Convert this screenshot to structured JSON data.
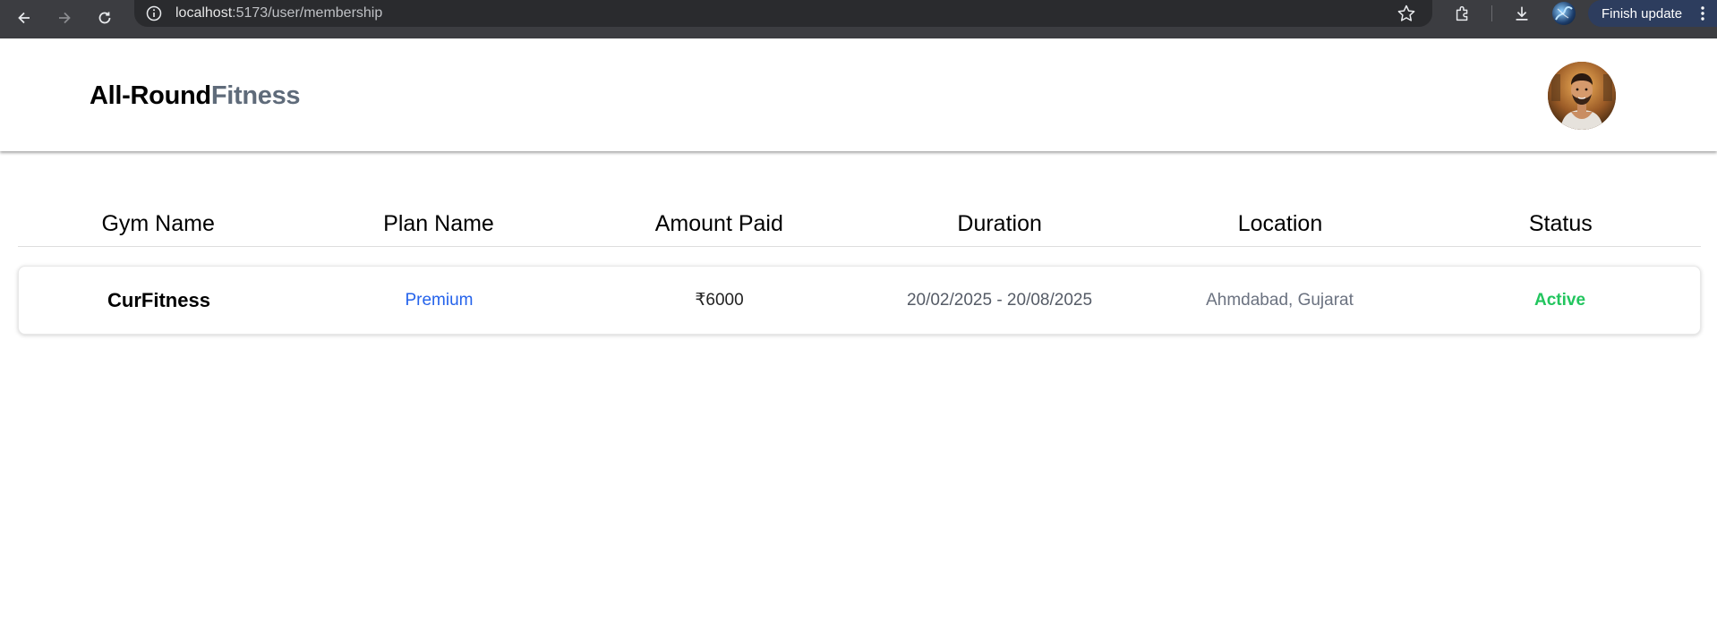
{
  "browser": {
    "url_host": "localhost",
    "url_path": ":5173/user/membership",
    "update_label": "Finish update"
  },
  "brand": {
    "part1": "All-Round",
    "part2": "Fitness"
  },
  "table": {
    "headers": [
      "Gym Name",
      "Plan Name",
      "Amount Paid",
      "Duration",
      "Location",
      "Status"
    ],
    "rows": [
      {
        "gym_name": "CurFitness",
        "plan_name": "Premium",
        "amount_paid": "₹6000",
        "duration": "20/02/2025 - 20/08/2025",
        "location": "Ahmdabad, Gujarat",
        "status": "Active"
      }
    ]
  },
  "colors": {
    "brand_dark": "#000000",
    "brand_light": "#5f6b7a",
    "plan_accent": "#2563eb",
    "status_active": "#22c55e"
  }
}
